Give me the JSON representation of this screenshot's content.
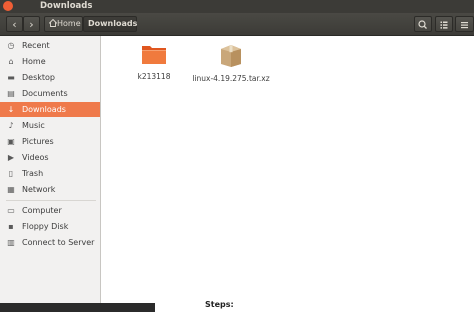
{
  "window": {
    "title": "Downloads"
  },
  "toolbar": {
    "back_glyph": "‹",
    "forward_glyph": "›",
    "home_label": "Home",
    "current_label": "Downloads",
    "search_icon": "search-icon",
    "view_icon": "list-view-icon",
    "menu_icon": "hamburger-menu-icon"
  },
  "sidebar": {
    "items": [
      {
        "label": "Recent",
        "icon": "clock-icon",
        "glyph": "◷",
        "active": false
      },
      {
        "label": "Home",
        "icon": "home-icon",
        "glyph": "⌂",
        "active": false
      },
      {
        "label": "Desktop",
        "icon": "desktop-icon",
        "glyph": "▬",
        "active": false
      },
      {
        "label": "Documents",
        "icon": "document-icon",
        "glyph": "▤",
        "active": false
      },
      {
        "label": "Downloads",
        "icon": "download-arrow-icon",
        "glyph": "↓",
        "active": true
      },
      {
        "label": "Music",
        "icon": "music-icon",
        "glyph": "♪",
        "active": false
      },
      {
        "label": "Pictures",
        "icon": "picture-icon",
        "glyph": "▣",
        "active": false
      },
      {
        "label": "Videos",
        "icon": "video-icon",
        "glyph": "▶",
        "active": false
      },
      {
        "label": "Trash",
        "icon": "trash-icon",
        "glyph": "▯",
        "active": false
      },
      {
        "label": "Network",
        "icon": "network-icon",
        "glyph": "▦",
        "active": false
      },
      {
        "label": "Computer",
        "icon": "computer-icon",
        "glyph": "▭",
        "active": false
      },
      {
        "label": "Floppy Disk",
        "icon": "floppy-disk-icon",
        "glyph": "▪",
        "active": false
      },
      {
        "label": "Connect to Server",
        "icon": "server-icon",
        "glyph": "▥",
        "active": false
      }
    ]
  },
  "files": [
    {
      "name": "k213118",
      "icon": "folder-icon"
    },
    {
      "name": "linux-4.19.275.tar.xz",
      "icon": "archive-package-icon"
    }
  ],
  "background_text": "Steps:",
  "colors": {
    "accent": "#ef7a4b",
    "titlebar": "#3c3b37",
    "close": "#ef5e35"
  }
}
